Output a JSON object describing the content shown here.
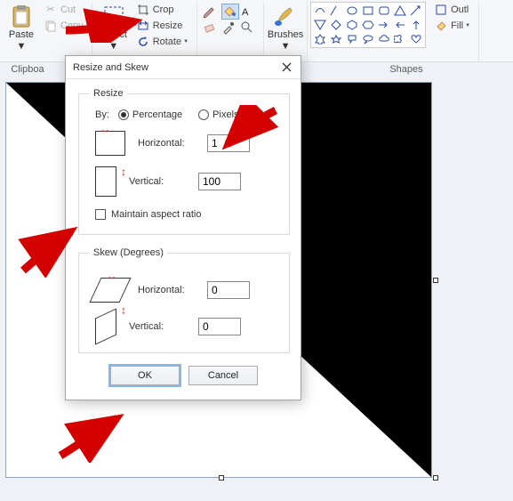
{
  "ribbon": {
    "clipboard": {
      "paste": "Paste",
      "cut": "Cut",
      "copy": "Copy",
      "cap": "Clipboa"
    },
    "image": {
      "select": "Select",
      "crop": "Crop",
      "resize": "Resize",
      "rotate": "Rotate"
    },
    "tools": {
      "brushes": "Brushes"
    },
    "shapes": {
      "cap": "Shapes",
      "outline": "Outl",
      "fill": "Fill"
    }
  },
  "canvas": {},
  "dialog": {
    "title": "Resize and Skew",
    "resize": {
      "legend": "Resize",
      "by": "By:",
      "percentage": "Percentage",
      "pixels": "Pixels",
      "horizontal": "Horizontal:",
      "vertical": "Vertical:",
      "h_val": "1",
      "v_val": "100",
      "aspect": "Maintain aspect ratio"
    },
    "skew": {
      "legend": "Skew (Degrees)",
      "horizontal": "Horizontal:",
      "vertical": "Vertical:",
      "h_val": "0",
      "v_val": "0"
    },
    "ok": "OK",
    "cancel": "Cancel"
  }
}
